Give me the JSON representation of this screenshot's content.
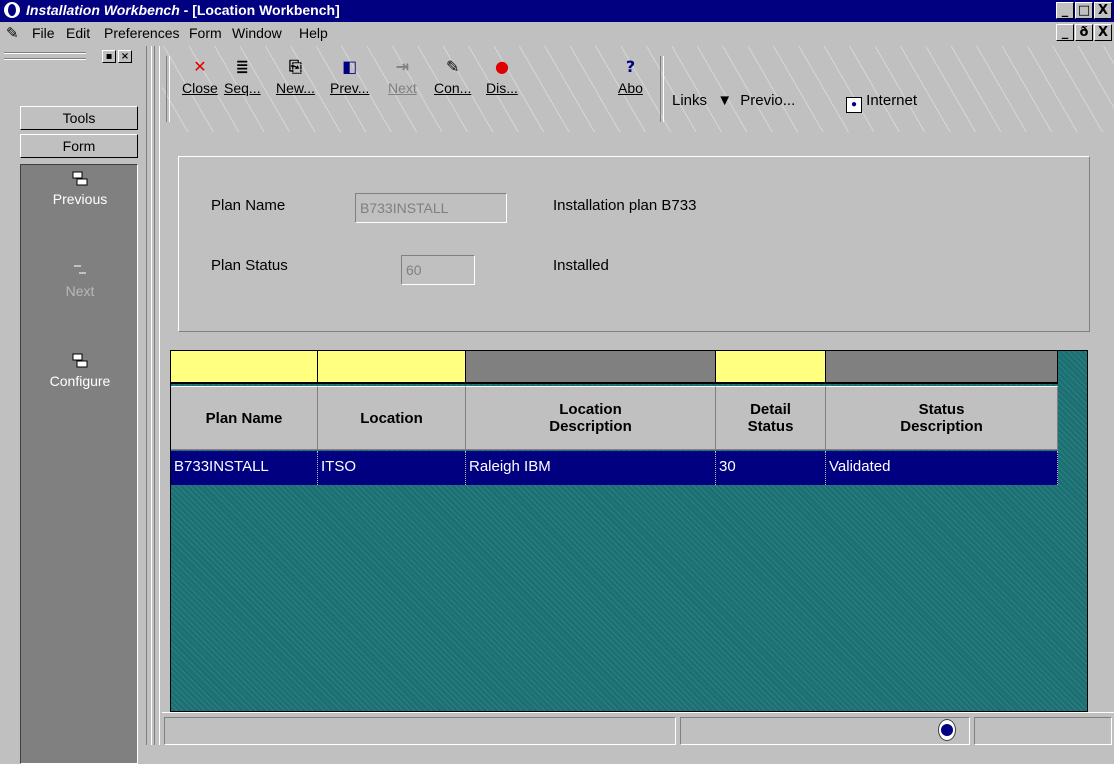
{
  "window": {
    "app_title": "Installation Workbench",
    "doc_title": " - [Location Workbench]",
    "controls": [
      "_",
      "□",
      "X"
    ],
    "doc_controls": [
      "_",
      "ð",
      "X"
    ]
  },
  "menu": {
    "items": [
      "File",
      "Edit",
      "Preferences",
      "Form",
      "Window",
      "Help"
    ]
  },
  "left_panel": {
    "tabs": [
      "Tools",
      "Form"
    ],
    "items": [
      {
        "label": "Previous",
        "icon": "previous-form-icon",
        "enabled": true
      },
      {
        "label": "Next",
        "icon": "next-form-icon",
        "enabled": false
      },
      {
        "label": "Configure",
        "icon": "configure-form-icon",
        "enabled": true
      }
    ]
  },
  "toolbar": {
    "buttons": [
      {
        "label": "Close",
        "icon": "close-x-icon",
        "enabled": true
      },
      {
        "label": "Seq...",
        "icon": "sequence-icon",
        "enabled": true
      },
      {
        "label": "New...",
        "icon": "new-icon",
        "enabled": true
      },
      {
        "label": "Prev...",
        "icon": "previous-icon",
        "enabled": true
      },
      {
        "label": "Next",
        "icon": "next-icon",
        "enabled": false
      },
      {
        "label": "Con...",
        "icon": "connect-icon",
        "enabled": true
      },
      {
        "label": "Dis...",
        "icon": "display-icon",
        "enabled": true
      },
      {
        "label": "Abo",
        "icon": "about-icon",
        "enabled": true
      }
    ],
    "links_label": "Links",
    "previo_label": "Previo...",
    "internet_label": "Internet"
  },
  "header": {
    "plan_name_label": "Plan Name",
    "plan_name_value": "B733INSTALL",
    "plan_name_desc": "Installation plan B733",
    "plan_status_label": "Plan Status",
    "plan_status_value": "60",
    "plan_status_desc": "Installed"
  },
  "grid": {
    "columns": [
      {
        "label": "Plan Name",
        "qbe": "#ffff80"
      },
      {
        "label": "Location",
        "qbe": "#ffff80"
      },
      {
        "label": "Location Description",
        "qbe": "#808080"
      },
      {
        "label": "Detail Status",
        "qbe": "#ffff80"
      },
      {
        "label": "Status Description",
        "qbe": "#808080"
      }
    ],
    "rows": [
      [
        "B733INSTALL",
        "ITSO",
        "Raleigh IBM",
        "30",
        "Validated"
      ]
    ],
    "selected_row_color": "#000080",
    "background_color": "#1a7072"
  }
}
